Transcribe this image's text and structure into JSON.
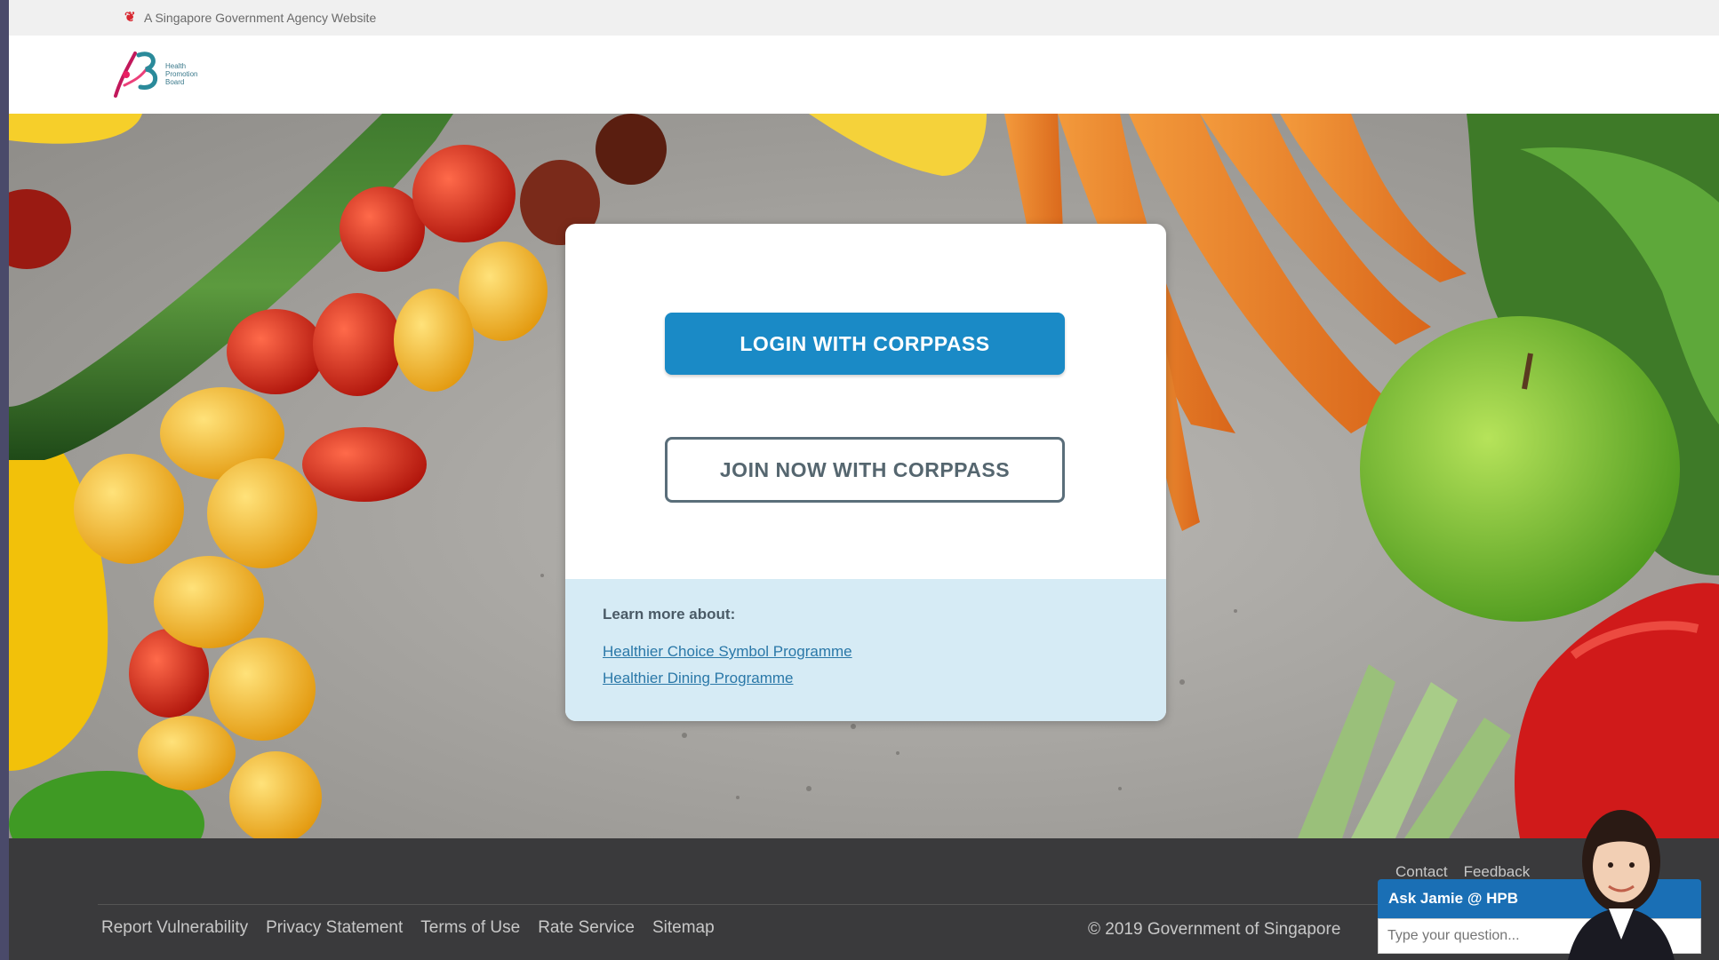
{
  "masthead": {
    "text": "A Singapore Government Agency Website"
  },
  "header": {
    "logo_text_1": "Health",
    "logo_text_2": "Promotion",
    "logo_text_3": "Board"
  },
  "card": {
    "login_label": "LOGIN WITH CORPPASS",
    "join_label": "JOIN NOW WITH CORPPASS",
    "learn_title": "Learn more about:",
    "links": [
      "Healthier Choice Symbol Programme",
      "Healthier Dining Programme"
    ]
  },
  "footer": {
    "top_links": [
      "Contact",
      "Feedback"
    ],
    "links": [
      "Report Vulnerability",
      "Privacy Statement",
      "Terms of Use",
      "Rate Service",
      "Sitemap"
    ],
    "copyright": "© 2019 Government of Singapore"
  },
  "chat": {
    "title": "Ask Jamie @ HPB",
    "placeholder": "Type your question..."
  },
  "colors": {
    "primary_button": "#1a8ac6",
    "footer_bg": "#3a3a3c",
    "learn_bg": "#d6ebf5"
  }
}
